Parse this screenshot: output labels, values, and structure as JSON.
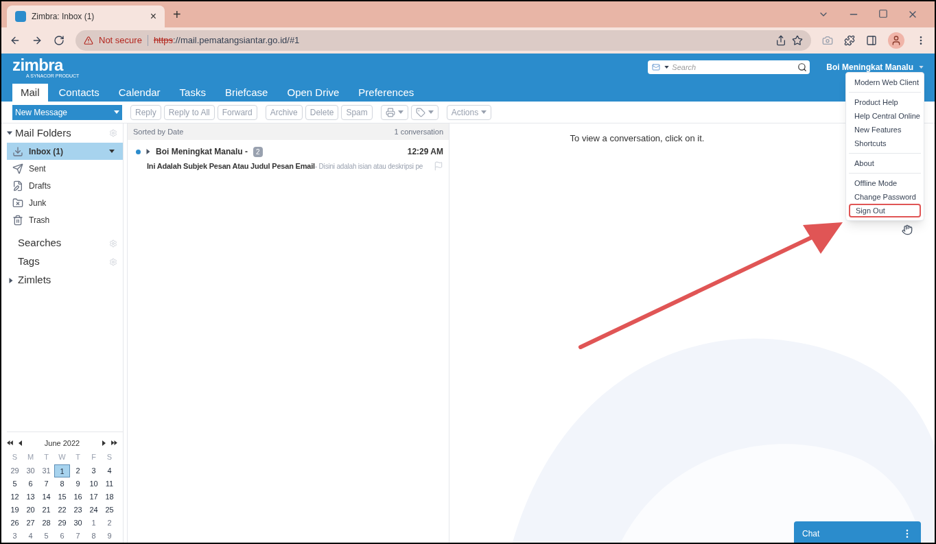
{
  "browser": {
    "tab": {
      "title": "Zimbra: Inbox (1)",
      "close": "×"
    },
    "new_tab": "+",
    "security": "Not secure",
    "url_scheme": "https",
    "url_rest": "://mail.pematangsiantar.go.id/#1"
  },
  "header": {
    "logo": "zimbra",
    "logo_sub": "A SYNACOR PRODUCT",
    "search": {
      "placeholder": "Search"
    },
    "user": "Boi Meningkat Manalu"
  },
  "tabs": [
    {
      "label": "Mail",
      "selected": true
    },
    {
      "label": "Contacts",
      "selected": false
    },
    {
      "label": "Calendar",
      "selected": false
    },
    {
      "label": "Tasks",
      "selected": false
    },
    {
      "label": "Briefcase",
      "selected": false
    },
    {
      "label": "Open Drive",
      "selected": false
    },
    {
      "label": "Preferences",
      "selected": false
    }
  ],
  "toolbar": {
    "new_message": "New Message",
    "groups": [
      [
        {
          "kind": "text",
          "label": "Reply",
          "disabled": true
        },
        {
          "kind": "text",
          "label": "Reply to All",
          "disabled": true
        },
        {
          "kind": "text",
          "label": "Forward",
          "disabled": true
        }
      ],
      [
        {
          "kind": "text",
          "label": "Archive",
          "disabled": true
        },
        {
          "kind": "text",
          "label": "Delete",
          "disabled": true
        },
        {
          "kind": "text",
          "label": "Spam",
          "disabled": true
        }
      ],
      [
        {
          "kind": "print",
          "disabled": true
        },
        {
          "kind": "tag",
          "disabled": true
        }
      ],
      [
        {
          "kind": "menu",
          "label": "Actions",
          "disabled": true
        }
      ]
    ]
  },
  "sidebar": {
    "title": "Mail Folders",
    "folders": [
      {
        "kind": "inbox",
        "label": "Inbox (1)",
        "selected": true
      },
      {
        "kind": "sent",
        "label": "Sent",
        "selected": false
      },
      {
        "kind": "drafts",
        "label": "Drafts",
        "selected": false
      },
      {
        "kind": "junk",
        "label": "Junk",
        "selected": false
      },
      {
        "kind": "trash",
        "label": "Trash",
        "selected": false
      }
    ],
    "sections": [
      {
        "label": "Searches",
        "kind": "gear"
      },
      {
        "label": "Tags",
        "kind": "gear"
      },
      {
        "label": "Zimlets",
        "kind": "collapsed"
      }
    ]
  },
  "mini_calendar": {
    "month": "June 2022",
    "weekdays": [
      "S",
      "M",
      "T",
      "W",
      "T",
      "F",
      "S"
    ],
    "days": [
      {
        "d": "29",
        "other": true,
        "selected": false
      },
      {
        "d": "30",
        "other": true,
        "selected": false
      },
      {
        "d": "31",
        "other": true,
        "selected": false
      },
      {
        "d": "1",
        "other": false,
        "selected": true
      },
      {
        "d": "2",
        "other": false,
        "selected": false
      },
      {
        "d": "3",
        "other": false,
        "selected": false
      },
      {
        "d": "4",
        "other": false,
        "selected": false
      },
      {
        "d": "5",
        "other": false,
        "selected": false
      },
      {
        "d": "6",
        "other": false,
        "selected": false
      },
      {
        "d": "7",
        "other": false,
        "selected": false
      },
      {
        "d": "8",
        "other": false,
        "selected": false
      },
      {
        "d": "9",
        "other": false,
        "selected": false
      },
      {
        "d": "10",
        "other": false,
        "selected": false
      },
      {
        "d": "11",
        "other": false,
        "selected": false
      },
      {
        "d": "12",
        "other": false,
        "selected": false
      },
      {
        "d": "13",
        "other": false,
        "selected": false
      },
      {
        "d": "14",
        "other": false,
        "selected": false
      },
      {
        "d": "15",
        "other": false,
        "selected": false
      },
      {
        "d": "16",
        "other": false,
        "selected": false
      },
      {
        "d": "17",
        "other": false,
        "selected": false
      },
      {
        "d": "18",
        "other": false,
        "selected": false
      },
      {
        "d": "19",
        "other": false,
        "selected": false
      },
      {
        "d": "20",
        "other": false,
        "selected": false
      },
      {
        "d": "21",
        "other": false,
        "selected": false
      },
      {
        "d": "22",
        "other": false,
        "selected": false
      },
      {
        "d": "23",
        "other": false,
        "selected": false
      },
      {
        "d": "24",
        "other": false,
        "selected": false
      },
      {
        "d": "25",
        "other": false,
        "selected": false
      },
      {
        "d": "26",
        "other": false,
        "selected": false
      },
      {
        "d": "27",
        "other": false,
        "selected": false
      },
      {
        "d": "28",
        "other": false,
        "selected": false
      },
      {
        "d": "29",
        "other": false,
        "selected": false
      },
      {
        "d": "30",
        "other": false,
        "selected": false
      },
      {
        "d": "1",
        "other": true,
        "selected": false
      },
      {
        "d": "2",
        "other": true,
        "selected": false
      },
      {
        "d": "3",
        "other": true,
        "selected": false
      },
      {
        "d": "4",
        "other": true,
        "selected": false
      },
      {
        "d": "5",
        "other": true,
        "selected": false
      },
      {
        "d": "6",
        "other": true,
        "selected": false
      },
      {
        "d": "7",
        "other": true,
        "selected": false
      },
      {
        "d": "8",
        "other": true,
        "selected": false
      },
      {
        "d": "9",
        "other": true,
        "selected": false
      }
    ]
  },
  "message_list": {
    "sort": "Sorted by Date",
    "count": "1 conversation",
    "conversations": [
      {
        "sender": "Boi Meningkat Manalu -",
        "messages": "2",
        "time": "12:29 AM",
        "subject": "Ini Adalah Subjek Pesan Atau Judul Pesan Email",
        "preview": " - Disini adalah isian atau deskripsi pe",
        "unread": true
      }
    ]
  },
  "reading_pane": {
    "hint": "To view a conversation, click on it."
  },
  "user_menu": {
    "groups": [
      [
        {
          "label": "Modern Web Client",
          "highlighted": false
        }
      ],
      [
        {
          "label": "Product Help",
          "highlighted": false
        },
        {
          "label": "Help Central Online",
          "highlighted": false
        },
        {
          "label": "New Features",
          "highlighted": false
        },
        {
          "label": "Shortcuts",
          "highlighted": false
        }
      ],
      [
        {
          "label": "About",
          "highlighted": false
        }
      ],
      [
        {
          "label": "Offline Mode",
          "highlighted": false
        },
        {
          "label": "Change Password",
          "highlighted": false
        },
        {
          "label": "Sign Out",
          "highlighted": true
        }
      ]
    ]
  },
  "chat": {
    "title": "Chat"
  }
}
